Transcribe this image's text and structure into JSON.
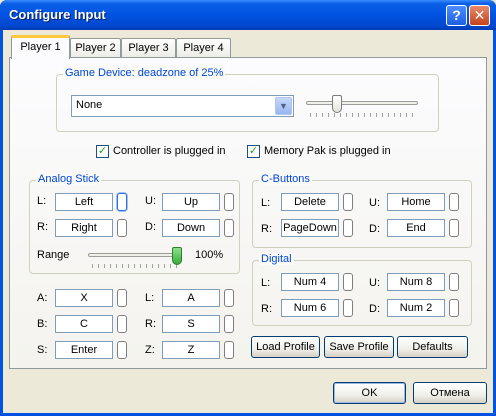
{
  "window": {
    "title": "Configure Input",
    "help_glyph": "?",
    "close_glyph": "✕"
  },
  "tabs": [
    "Player 1",
    "Player 2",
    "Player 3",
    "Player 4"
  ],
  "game_device": {
    "label": "Game Device: deadzone of 25%",
    "selected": "None",
    "deadzone_fraction": 0.25
  },
  "checks": {
    "controller_plugged": {
      "label": "Controller is plugged in",
      "checked": true
    },
    "mempak_plugged": {
      "label": "Memory Pak is plugged in",
      "checked": true
    },
    "mark": "✓"
  },
  "analog": {
    "label": "Analog Stick",
    "rows": [
      {
        "l1": "L:",
        "v1": "Left",
        "l2": "U:",
        "v2": "Up"
      },
      {
        "l1": "R:",
        "v1": "Right",
        "l2": "D:",
        "v2": "Down"
      }
    ],
    "range_label": "Range",
    "range_value": "100%",
    "range_fraction": 1.0
  },
  "buttons_left": [
    {
      "l1": "A:",
      "v1": "X",
      "l2": "L:",
      "v2": "A"
    },
    {
      "l1": "B:",
      "v1": "C",
      "l2": "R:",
      "v2": "S"
    },
    {
      "l1": "S:",
      "v1": "Enter",
      "l2": "Z:",
      "v2": "Z"
    }
  ],
  "cbuttons": {
    "label": "C-Buttons",
    "rows": [
      {
        "l1": "L:",
        "v1": "Delete",
        "l2": "U:",
        "v2": "Home"
      },
      {
        "l1": "R:",
        "v1": "PageDown",
        "l2": "D:",
        "v2": "End"
      }
    ]
  },
  "digital": {
    "label": "Digital",
    "rows": [
      {
        "l1": "L:",
        "v1": "Num 4",
        "l2": "U:",
        "v2": "Num 8"
      },
      {
        "l1": "R:",
        "v1": "Num 6",
        "l2": "D:",
        "v2": "Num 2"
      }
    ]
  },
  "profile_buttons": {
    "load": "Load Profile",
    "save": "Save Profile",
    "defaults": "Defaults"
  },
  "dialog_buttons": {
    "ok": "OK",
    "cancel": "Отмена"
  },
  "combo_arrow": "▼"
}
